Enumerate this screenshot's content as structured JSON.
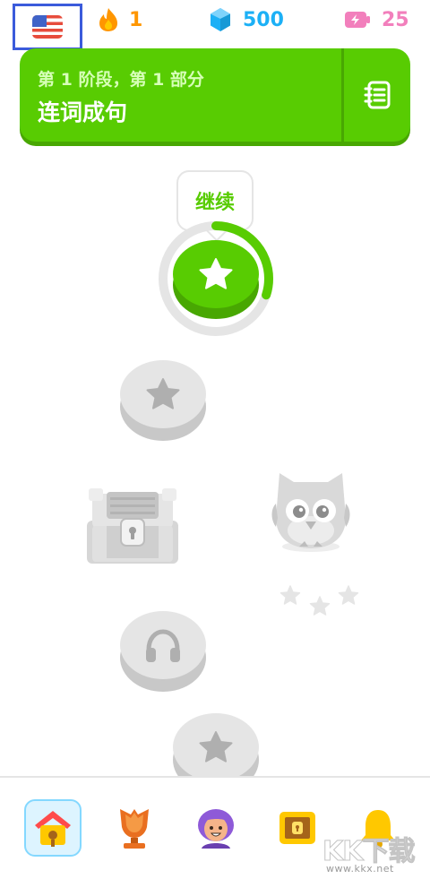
{
  "status_bar": {
    "streak_count": "1",
    "gems_count": "500",
    "energy_count": "25"
  },
  "unit": {
    "section_label": "第 1 阶段，第 1 部分",
    "title": "连词成句"
  },
  "path": {
    "continue_label": "继续",
    "active_lesson_progress": 0.3
  },
  "nav": {
    "selected": "learn"
  },
  "watermark": {
    "text": "KK下载",
    "url": "www.kkx.net"
  },
  "colors": {
    "brand_green": "#58cc02",
    "brand_green_dark": "#48a702",
    "streak_orange": "#ff9600",
    "gem_blue": "#1cb0f6",
    "energy_pink": "#f27fbc",
    "locked_gray": "#e5e5e5"
  },
  "icons": [
    "us-flag-icon",
    "streak-flame-icon",
    "gem-icon",
    "energy-battery-icon",
    "guidebook-icon",
    "star-icon",
    "headphones-icon",
    "treasure-chest-icon",
    "duo-owl-icon",
    "home-icon",
    "leagues-trophy-icon",
    "profile-avatar-icon",
    "chest-icon",
    "bell-icon"
  ]
}
